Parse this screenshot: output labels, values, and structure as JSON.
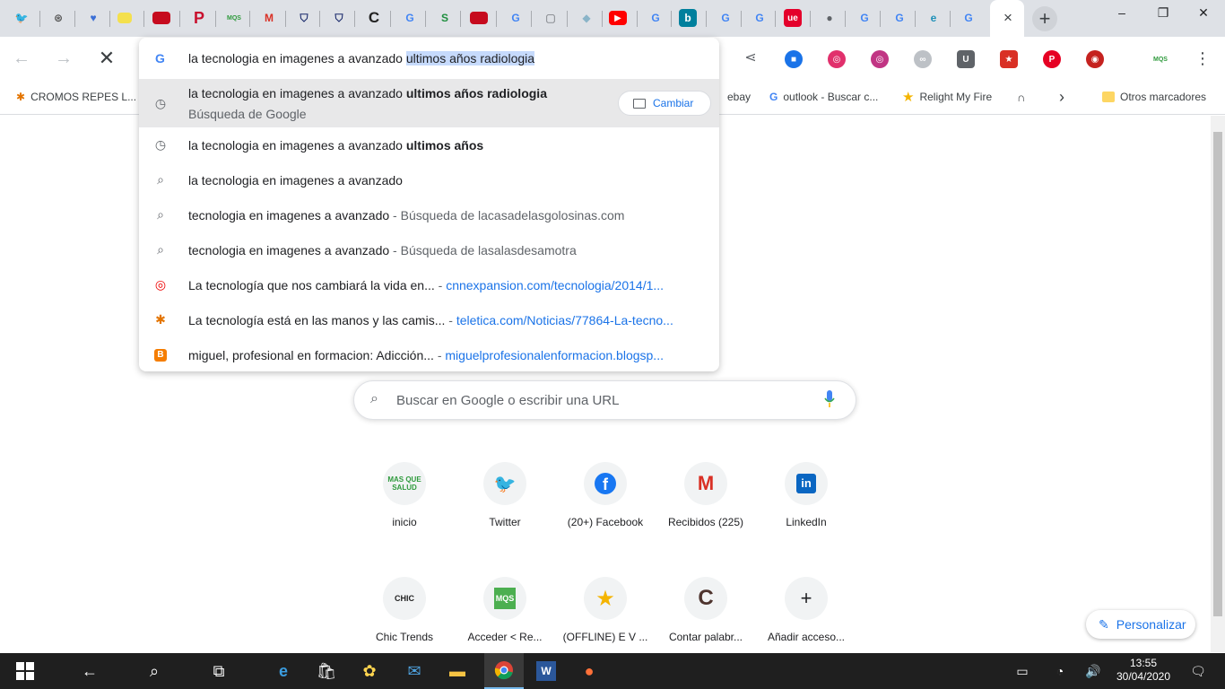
{
  "tabs": {
    "favicons": [
      "twitter",
      "chrome-store",
      "heart",
      "spain-flag",
      "spain-flag",
      "pinterest",
      "masquesalud",
      "gmail",
      "shield",
      "shield",
      "c-logo",
      "google",
      "s-logo",
      "spain-flag",
      "google",
      "square",
      "fish",
      "youtube",
      "google",
      "bing",
      "google",
      "google",
      "ue",
      "globe",
      "google",
      "google",
      "edge",
      "google"
    ],
    "active_close": "×",
    "new_tab": "+"
  },
  "window": {
    "minimize": "–",
    "maximize": "❐",
    "close": "✕"
  },
  "omnibox": {
    "typed": "la tecnologia en imagenes a avanzado ",
    "autocomplete": "ultimos años radiologia"
  },
  "suggestions": [
    {
      "icon": "history-icon",
      "plain": "la tecnologia en imagenes a avanzado ",
      "bold": "ultimos años radiologia",
      "sub": "Búsqueda de Google",
      "button": "Cambiar"
    },
    {
      "icon": "history-icon",
      "plain": "la tecnologia en imagenes a avanzado ",
      "bold": "ultimos años"
    },
    {
      "icon": "search-icon",
      "plain": "la tecnologia en imagenes a avanzado"
    },
    {
      "icon": "search-icon",
      "plain": "tecnologia en imagenes a avanzado",
      "sep": " - ",
      "sub": "Búsqueda de lacasadelasgolosinas.com"
    },
    {
      "icon": "search-icon",
      "plain": "tecnologia en imagenes a avanzado",
      "sep": " - ",
      "sub": "Búsqueda de lasalasdesamotra"
    },
    {
      "icon": "cnn-icon",
      "title": "La tecnología que nos cambiará la vida en...",
      "sep": " - ",
      "url": "cnnexpansion.com/tecnologia/2014/1..."
    },
    {
      "icon": "teletica-icon",
      "title": "La tecnología está en las manos y las camis...",
      "sep": " - ",
      "url": "teletica.com/Noticias/77864-La-tecno..."
    },
    {
      "icon": "blogger-icon",
      "title": "miguel, profesional en formacion: Adicción...",
      "sep": " - ",
      "url": "miguelprofesionalenformacion.blogsp..."
    }
  ],
  "bookmarks": {
    "b1": "CROMOS REPES L...",
    "b2": "ebay",
    "b3": "outlook - Buscar c...",
    "b4": "Relight My Fire",
    "more": "›",
    "other": "Otros marcadores"
  },
  "ntp": {
    "search_placeholder": "Buscar en Google o escribir una URL",
    "shortcuts": [
      {
        "label": "inicio",
        "icon": "MAS QUE SALUD"
      },
      {
        "label": "Twitter",
        "icon": "twitter"
      },
      {
        "label": "(20+) Facebook",
        "icon": "facebook"
      },
      {
        "label": "Recibidos (225)",
        "icon": "gmail"
      },
      {
        "label": "LinkedIn",
        "icon": "linkedin"
      },
      {
        "label": "Chic Trends",
        "icon": "CHIC"
      },
      {
        "label": "Acceder < Re...",
        "icon": "MQS"
      },
      {
        "label": "(OFFLINE) E V ...",
        "icon": "star"
      },
      {
        "label": "Contar palabr...",
        "icon": "C"
      },
      {
        "label": "Añadir acceso...",
        "icon": "+"
      }
    ],
    "customize": "Personalizar"
  },
  "taskbar": {
    "time": "13:55",
    "date": "30/04/2020"
  }
}
